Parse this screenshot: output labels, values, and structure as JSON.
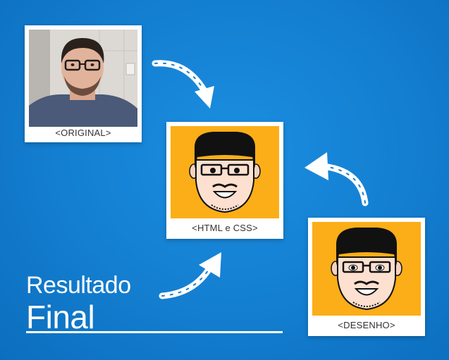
{
  "cards": {
    "original": {
      "caption": "<ORIGINAL>"
    },
    "html_css": {
      "caption": "<HTML e CSS>"
    },
    "desenho": {
      "caption": "<DESENHO>"
    }
  },
  "title": {
    "line1": "Resultado",
    "line2": "Final"
  },
  "colors": {
    "background": "#1581d3",
    "card": "#ffffff",
    "illustration_bg": "#fbae17",
    "hair": "#111111",
    "skin": "#fde0cf",
    "arrows": "#ffffff"
  }
}
